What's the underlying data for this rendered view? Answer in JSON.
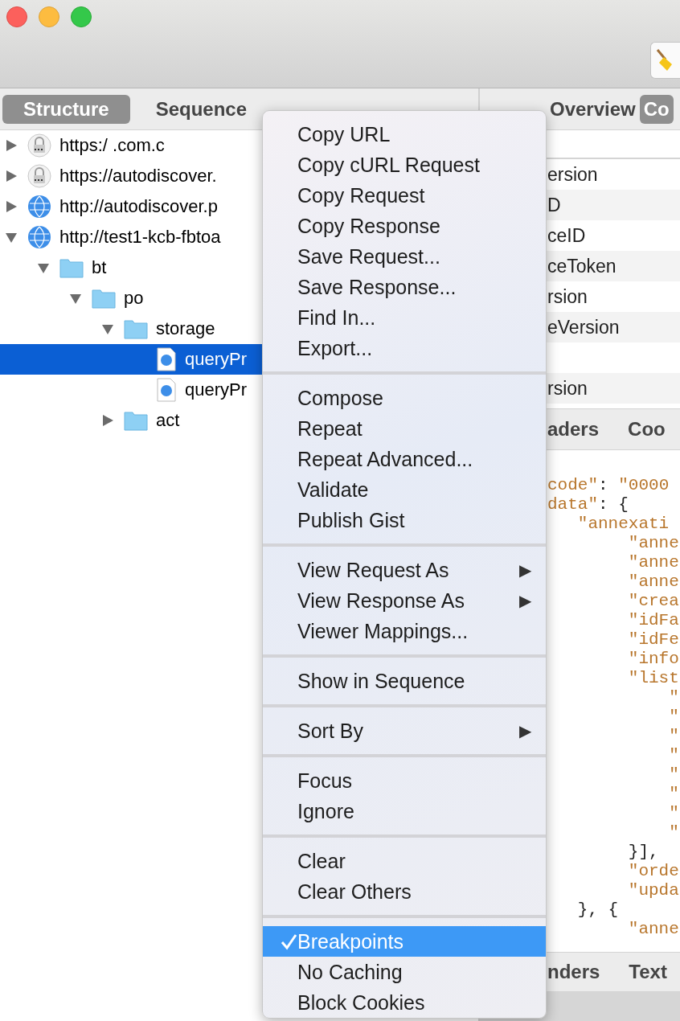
{
  "left_tabs": [
    {
      "label": "Structure",
      "selected": true
    },
    {
      "label": "Sequence",
      "selected": false
    }
  ],
  "tree": [
    {
      "label": "https:/ .com.c",
      "kind": "lock",
      "expanded": false,
      "selected": false
    },
    {
      "label": "https://autodiscover.",
      "kind": "lock",
      "expanded": false,
      "selected": false
    },
    {
      "label": "http://autodiscover.p",
      "kind": "globe",
      "expanded": false,
      "selected": false
    },
    {
      "label": "http://test1-kcb-fbtoa",
      "kind": "globe",
      "expanded": true,
      "selected": false,
      "children": [
        {
          "label": "bt",
          "kind": "folder",
          "expanded": true,
          "selected": false,
          "children": [
            {
              "label": "po",
              "kind": "folder",
              "expanded": true,
              "selected": false,
              "children": [
                {
                  "label": "storage",
                  "kind": "folder",
                  "expanded": true,
                  "selected": false,
                  "children": [
                    {
                      "label": "queryPr",
                      "kind": "file",
                      "selected": true
                    },
                    {
                      "label": "queryPr",
                      "kind": "file",
                      "selected": false
                    }
                  ]
                },
                {
                  "label": "act",
                  "kind": "folder",
                  "expanded": false,
                  "selected": false
                }
              ]
            }
          ]
        }
      ]
    }
  ],
  "right_tabs": [
    {
      "label": "Overview",
      "selected": false
    },
    {
      "label": "Co",
      "selected": true
    }
  ],
  "rows": [
    {
      "text": "ersion"
    },
    {
      "text": "D"
    },
    {
      "text": "ceID"
    },
    {
      "text": "ceToken"
    },
    {
      "text": "rsion"
    },
    {
      "text": "eVersion"
    },
    {},
    {
      "text": "rsion"
    }
  ],
  "middle_tabs": [
    "aders",
    "Coo"
  ],
  "code_lines": [
    {
      "parts": [
        {
          "text": "code\"",
          "kind": "str"
        },
        {
          "text": ": ",
          "kind": "punct"
        },
        {
          "text": "\"0000",
          "kind": "str"
        }
      ]
    },
    {
      "parts": [
        {
          "text": "data\"",
          "kind": "str"
        },
        {
          "text": ": {",
          "kind": "punct"
        }
      ]
    },
    {
      "parts": [
        {
          "text": "   \"annexati",
          "kind": "str"
        }
      ]
    },
    {
      "parts": [
        {
          "text": "        \"anne",
          "kind": "str"
        }
      ]
    },
    {
      "parts": [
        {
          "text": "        \"anne",
          "kind": "str"
        }
      ]
    },
    {
      "parts": [
        {
          "text": "        \"anne",
          "kind": "str"
        }
      ]
    },
    {
      "parts": [
        {
          "text": "        \"crea",
          "kind": "str"
        }
      ]
    },
    {
      "parts": [
        {
          "text": "        \"idFa",
          "kind": "str"
        }
      ]
    },
    {
      "parts": [
        {
          "text": "        \"idFe",
          "kind": "str"
        }
      ]
    },
    {
      "parts": [
        {
          "text": "        \"info",
          "kind": "str"
        }
      ]
    },
    {
      "parts": [
        {
          "text": "        \"list",
          "kind": "str"
        }
      ]
    },
    {
      "parts": [
        {
          "text": "            \"",
          "kind": "str"
        }
      ]
    },
    {
      "parts": [
        {
          "text": "            \"",
          "kind": "str"
        }
      ]
    },
    {
      "parts": [
        {
          "text": "            \"",
          "kind": "str"
        }
      ]
    },
    {
      "parts": [
        {
          "text": "            \"",
          "kind": "str"
        }
      ]
    },
    {
      "parts": [
        {
          "text": "            \"",
          "kind": "str"
        }
      ]
    },
    {
      "parts": [
        {
          "text": "            \"",
          "kind": "str"
        }
      ]
    },
    {
      "parts": [
        {
          "text": "            \"",
          "kind": "str"
        }
      ]
    },
    {
      "parts": [
        {
          "text": "            \"",
          "kind": "str"
        }
      ]
    },
    {
      "parts": [
        {
          "text": "        }],",
          "kind": "punct"
        }
      ]
    },
    {
      "parts": [
        {
          "text": "        \"orde",
          "kind": "str"
        }
      ]
    },
    {
      "parts": [
        {
          "text": "        \"upda",
          "kind": "str"
        }
      ]
    },
    {
      "parts": [
        {
          "text": "   }, {",
          "kind": "punct"
        }
      ]
    },
    {
      "parts": [
        {
          "text": "        \"anne",
          "kind": "str"
        }
      ]
    }
  ],
  "bottom_tabs": [
    "nders",
    "Text"
  ],
  "menu": [
    [
      {
        "label": "Copy URL",
        "checked": false,
        "selected": false
      },
      {
        "label": "Copy cURL Request",
        "checked": false,
        "selected": false
      },
      {
        "label": "Copy Request",
        "checked": false,
        "selected": false
      },
      {
        "label": "Copy Response",
        "checked": false,
        "selected": false
      },
      {
        "label": "Save Request...",
        "checked": false,
        "selected": false
      },
      {
        "label": "Save Response...",
        "checked": false,
        "selected": false
      },
      {
        "label": "Find In...",
        "checked": false,
        "selected": false
      },
      {
        "label": "Export...",
        "checked": false,
        "selected": false
      }
    ],
    [
      {
        "label": "Compose",
        "checked": false,
        "selected": false
      },
      {
        "label": "Repeat",
        "checked": false,
        "selected": false
      },
      {
        "label": "Repeat Advanced...",
        "checked": false,
        "selected": false
      },
      {
        "label": "Validate",
        "checked": false,
        "selected": false
      },
      {
        "label": "Publish Gist",
        "checked": false,
        "selected": false
      }
    ],
    [
      {
        "label": "View Request As",
        "checked": false,
        "selected": false,
        "arrow": "▶"
      },
      {
        "label": "View Response As",
        "checked": false,
        "selected": false,
        "arrow": "▶"
      },
      {
        "label": "Viewer Mappings...",
        "checked": false,
        "selected": false
      }
    ],
    [
      {
        "label": "Show in Sequence",
        "checked": false,
        "selected": false
      }
    ],
    [
      {
        "label": "Sort By",
        "checked": false,
        "selected": false,
        "arrow": "▶"
      }
    ],
    [
      {
        "label": "Focus",
        "checked": false,
        "selected": false
      },
      {
        "label": "Ignore",
        "checked": false,
        "selected": false
      }
    ],
    [
      {
        "label": "Clear",
        "checked": false,
        "selected": false
      },
      {
        "label": "Clear Others",
        "checked": false,
        "selected": false
      }
    ],
    [
      {
        "label": "Breakpoints",
        "checked": true,
        "selected": true
      },
      {
        "label": "No Caching",
        "checked": false,
        "selected": false
      },
      {
        "label": "Block Cookies",
        "checked": false,
        "selected": false
      }
    ]
  ]
}
